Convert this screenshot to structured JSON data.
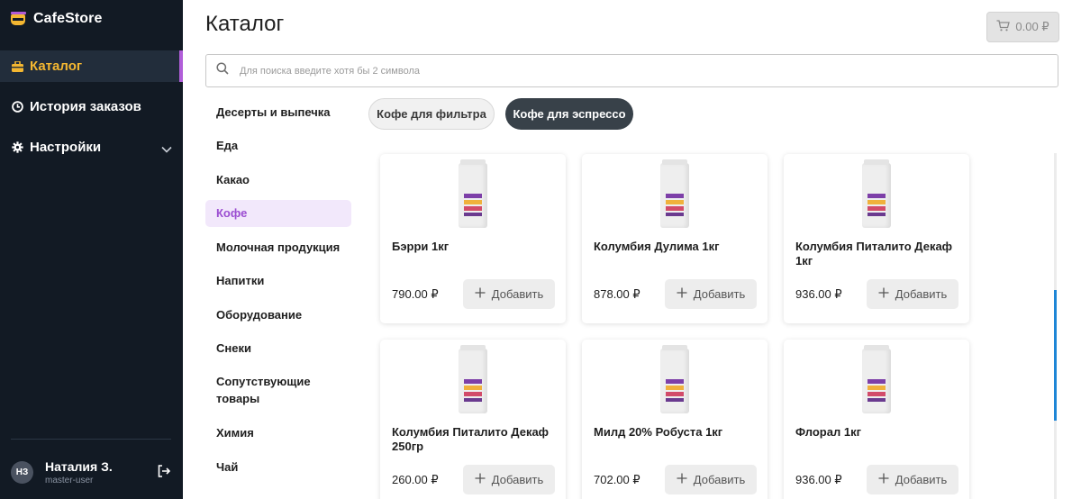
{
  "brand": {
    "name": "CafeStore"
  },
  "nav": {
    "items": [
      {
        "label": "Каталог"
      },
      {
        "label": "История заказов"
      },
      {
        "label": "Настройки"
      }
    ]
  },
  "user": {
    "initials": "НЗ",
    "name": "Наталия З.",
    "role": "master-user"
  },
  "header": {
    "title": "Каталог",
    "cart_total": "0.00 ₽"
  },
  "search": {
    "placeholder": "Для поиска введите хотя бы 2 символа",
    "value": ""
  },
  "categories": [
    {
      "label": "Десерты и выпечка"
    },
    {
      "label": "Еда"
    },
    {
      "label": "Какао"
    },
    {
      "label": "Кофе"
    },
    {
      "label": "Молочная продукция"
    },
    {
      "label": "Напитки"
    },
    {
      "label": "Оборудование"
    },
    {
      "label": "Снеки"
    },
    {
      "label": "Сопутствующие товары"
    },
    {
      "label": "Химия"
    },
    {
      "label": "Чай"
    }
  ],
  "subcategories": [
    {
      "label": "Кофе для фильтра"
    },
    {
      "label": "Кофе для эспрессо"
    }
  ],
  "products": [
    {
      "title": "Бэрри 1кг",
      "price": "790.00 ₽",
      "add_label": "Добавить"
    },
    {
      "title": "Колумбия Дулима 1кг",
      "price": "878.00 ₽",
      "add_label": "Добавить"
    },
    {
      "title": "Колумбия Питалито Декаф 1кг",
      "price": "936.00 ₽",
      "add_label": "Добавить"
    },
    {
      "title": "Колумбия Питалито Декаф 250гр",
      "price": "260.00 ₽",
      "add_label": "Добавить"
    },
    {
      "title": "Милд 20% Робуста 1кг",
      "price": "702.00 ₽",
      "add_label": "Добавить"
    },
    {
      "title": "Флорал 1кг",
      "price": "936.00 ₽",
      "add_label": "Добавить"
    }
  ],
  "colors": {
    "sidebar_bg": "#121a24",
    "accent_yellow": "#f4b731",
    "accent_purple": "#b15ed9",
    "active_category_bg": "#f2e8fb",
    "chip_dark": "#384149",
    "scroll_thumb": "#1e86d6"
  },
  "icons": {
    "nav": [
      "catalog-icon",
      "clock-icon",
      "gear-icon"
    ],
    "search": "search-icon",
    "cart": "cart-icon",
    "add": "plus-icon",
    "logout": "logout-icon",
    "expand": "chevron-down-icon"
  }
}
